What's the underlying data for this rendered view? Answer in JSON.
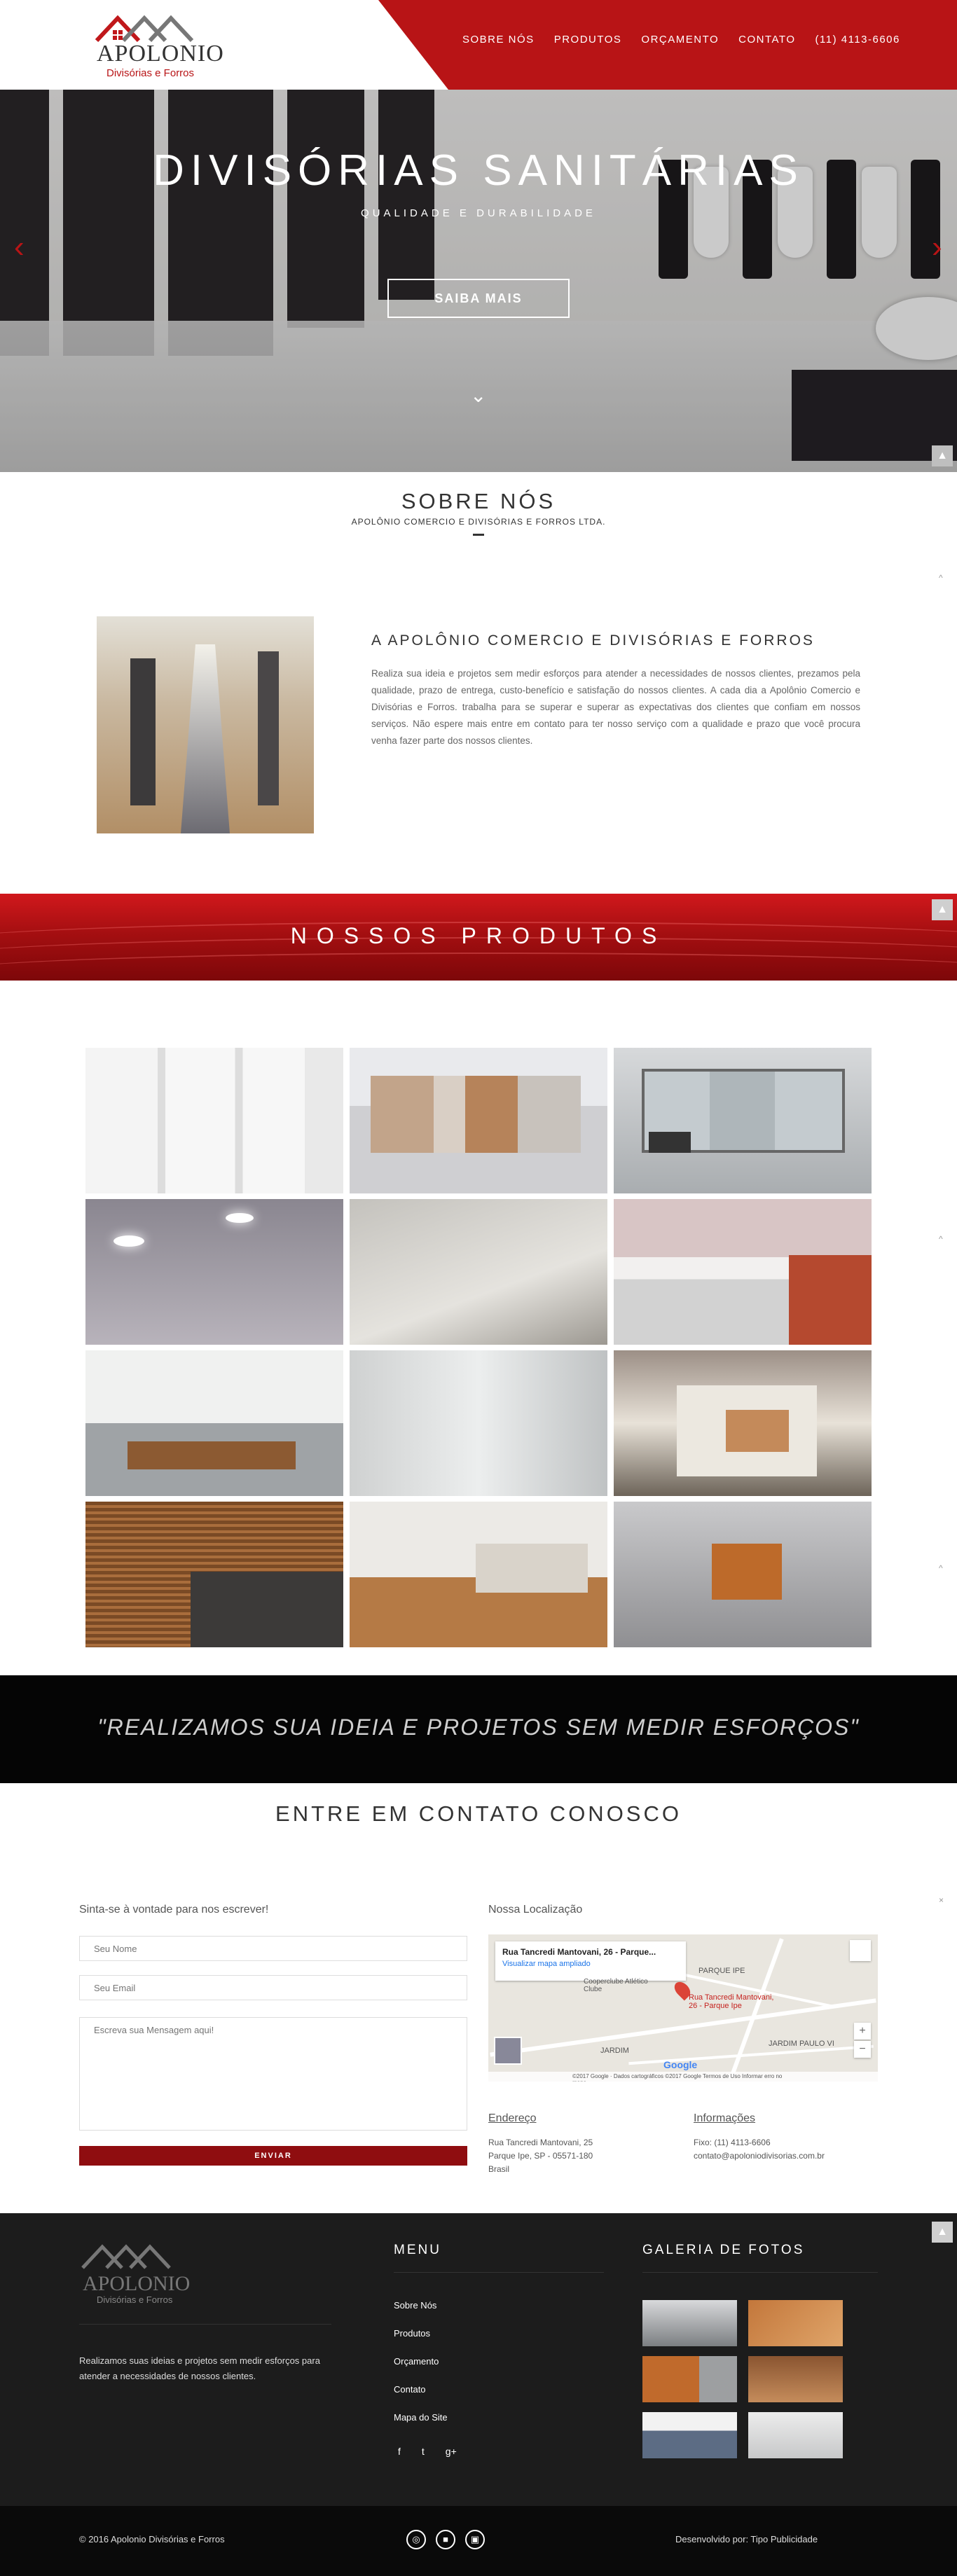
{
  "header": {
    "logo_main": "APOLONIO",
    "logo_sub": "Divisórias e Forros",
    "nav": [
      "SOBRE NÓS",
      "PRODUTOS",
      "ORÇAMENTO",
      "CONTATO",
      "(11) 4113-6606"
    ],
    "accent_color": "#b81416"
  },
  "hero": {
    "title": "DIVISÓRIAS SANITÁRIAS",
    "subtitle": "QUALIDADE E DURABILIDADE",
    "button": "SAIBA MAIS",
    "icons": [
      "chevron-left-icon",
      "chevron-right-icon",
      "chevron-down-icon",
      "arrow-up-icon"
    ]
  },
  "about": {
    "title": "SOBRE NÓS",
    "subtitle": "APOLÔNIO COMERCIO E DIVISÓRIAS E FORROS LTDA.",
    "heading": "A APOLÔNIO COMERCIO E DIVISÓRIAS E FORROS",
    "text": "Realiza sua ideia e projetos sem medir esforços para atender a necessidades de nossos clientes, prezamos pela qualidade, prazo de entrega, custo-benefício e satisfação do nossos clientes. A cada dia a Apolônio Comercio e Divisórias e Forros. trabalha para se superar e superar as expectativas dos clientes que confiam em nossos serviços. Não espere mais entre em contato para ter nosso serviço com a qualidade e prazo que você procura venha fazer parte dos nossos clientes."
  },
  "products": {
    "title": "NOSSOS PRODUTOS"
  },
  "quote": {
    "text": "\"REALIZAMOS SUA IDEIA E PROJETOS SEM MEDIR ESFORÇOS\""
  },
  "contact": {
    "title": "ENTRE EM CONTATO CONOSCO",
    "form_heading": "Sinta-se à vontade para nos escrever!",
    "name_placeholder": "Seu Nome",
    "email_placeholder": "Seu Email",
    "message_placeholder": "Escreva sua Mensagem aqui!",
    "send": "ENVIAR",
    "map_heading": "Nossa Localização",
    "map_card_title": "Rua Tancredi Mantovani, 26 - Parque...",
    "map_card_link": "Visualizar mapa ampliado",
    "map_pin_label": "Rua Tancredi Mantovani, 26 - Parque Ipe",
    "map_places": [
      "Cooperclube Atlético Clube",
      "PARQUE IPE",
      "JARDIM PAULO VI",
      "JARDIM"
    ],
    "map_footer": "©2017 Google · Dados cartográficos ©2017 Google   Termos de Uso   Informar erro no mapa",
    "map_logo": "Google",
    "address_heading": "Endereço",
    "address_lines": [
      "Rua Tancredi Mantovani, 25",
      "Parque Ipe, SP - 05571-180",
      "Brasil"
    ],
    "info_heading": "Informações",
    "info_lines": [
      "Fixo: (11) 4113-6606",
      "contato@apoloniodivisorias.com.br"
    ]
  },
  "footer": {
    "logo_main": "APOLONIO",
    "logo_sub": "Divisórias e Forros",
    "about": "Realizamos suas ideias e projetos sem medir esforços para atender a necessidades de nossos clientes.",
    "menu_title": "MENU",
    "menu": [
      "Sobre Nós",
      "Produtos",
      "Orçamento",
      "Contato",
      "Mapa do Site"
    ],
    "social": [
      "f",
      "t",
      "g+"
    ],
    "gallery_title": "GALERIA DE FOTOS",
    "copyright": "© 2016 Apolonio Divisórias e Forros",
    "developer": "Desenvolvido por: Tipo Publicidade"
  }
}
